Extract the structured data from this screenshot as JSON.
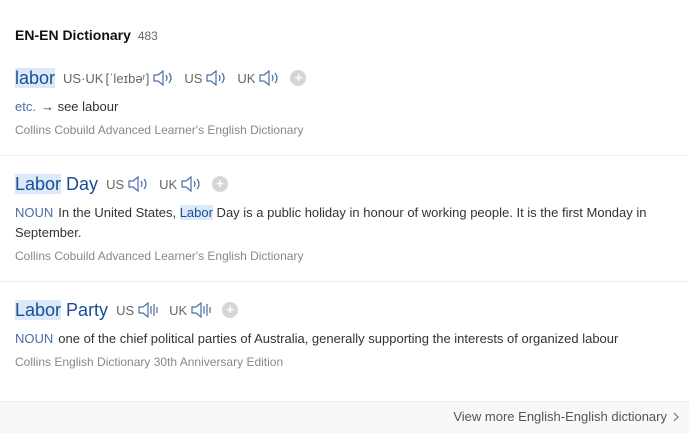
{
  "header": {
    "title": "EN-EN Dictionary",
    "count": "483"
  },
  "entries": [
    {
      "word_hl": "labor",
      "word_rest": "",
      "prons": [
        {
          "label": "US·UK",
          "phonetic": "[ˈleɪbəʳ]"
        },
        {
          "label": "US",
          "phonetic": ""
        },
        {
          "label": "UK",
          "phonetic": ""
        }
      ],
      "pos": "etc.",
      "def_pre": "→ see labour",
      "def_hl": "",
      "def_post": "",
      "source": "Collins Cobuild Advanced Learner's English Dictionary"
    },
    {
      "word_hl": "Labor",
      "word_rest": " Day",
      "prons": [
        {
          "label": "US",
          "phonetic": ""
        },
        {
          "label": "UK",
          "phonetic": ""
        }
      ],
      "pos": "NOUN",
      "def_pre": "In the United States, ",
      "def_hl": "Labor",
      "def_post": " Day is a public holiday in honour of working people. It is the first Monday in September.",
      "source": "Collins Cobuild Advanced Learner's English Dictionary"
    },
    {
      "word_hl": "Labor",
      "word_rest": " Party",
      "prons": [
        {
          "label": "US",
          "phonetic": ""
        },
        {
          "label": "UK",
          "phonetic": ""
        }
      ],
      "pos": "NOUN",
      "def_pre": "one of the chief political parties of Australia, generally supporting the interests of organized labour",
      "def_hl": "",
      "def_post": "",
      "source": "Collins English Dictionary 30th Anniversary Edition"
    }
  ],
  "plus_label": "+",
  "more_link": "View more English-English dictionary",
  "colors": {
    "headword": "#1a4d96",
    "highlight": "#dbe9f8",
    "pos": "#4a6ea8"
  },
  "icons": {
    "speaker": "speaker-icon",
    "add": "plus-icon",
    "more": "chevron-right-icon"
  }
}
